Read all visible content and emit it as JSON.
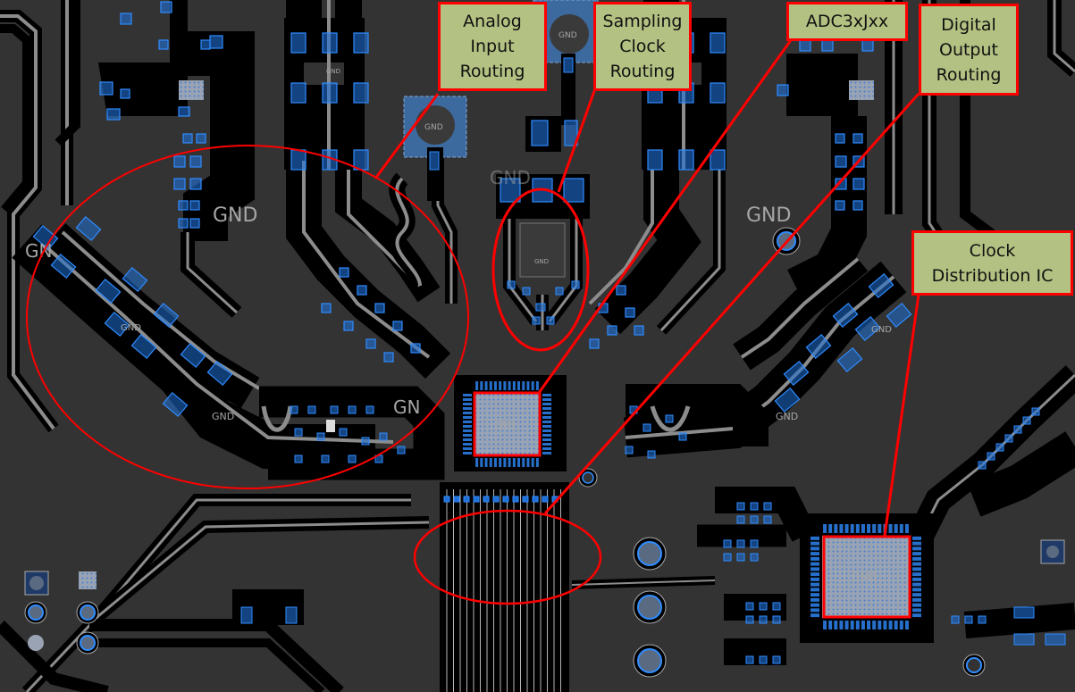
{
  "figure": {
    "description": "PCB layout of ADC3xJxx board with annotated routing regions",
    "colors": {
      "board_background": "#333333",
      "trace_clearance": "#000000",
      "trace_fill": "#8c8c8c",
      "pad_blue": "#1f6fd6",
      "exposed_pad": "#9aa3b3",
      "annotation_red": "#ff0000",
      "callout_fill": "#b3c182"
    }
  },
  "callouts": [
    {
      "id": "analog-input",
      "label": "Analog\nInput\nRouting"
    },
    {
      "id": "sampling-clock",
      "label": "Sampling\nClock\nRouting"
    },
    {
      "id": "adc",
      "label": "ADC3xJxx"
    },
    {
      "id": "digital-output",
      "label": "Digital\nOutput\nRouting"
    },
    {
      "id": "clock-distribution",
      "label": "Clock\nDistribution IC"
    }
  ],
  "silkscreen": {
    "gnd_large_left": "GND",
    "gnd_large_right": "GND",
    "gnd_top_connector": "GND",
    "gnd_mid_connector": "GND",
    "gnd_adc_pad": "GND",
    "gnd_clock_ic_pad": "GND",
    "gnd_filter_left": "GND",
    "gnd_filter_left_bottom": "GND",
    "gnd_filter_right": "GND",
    "gnd_filter_right_bottom": "GND",
    "gnd_balun_top": "GND",
    "gnd_clock_area": "GND",
    "gnd_partial_left": "GN",
    "gnd_partial_adc": "GN",
    "gnd_partial_top": "GND"
  }
}
